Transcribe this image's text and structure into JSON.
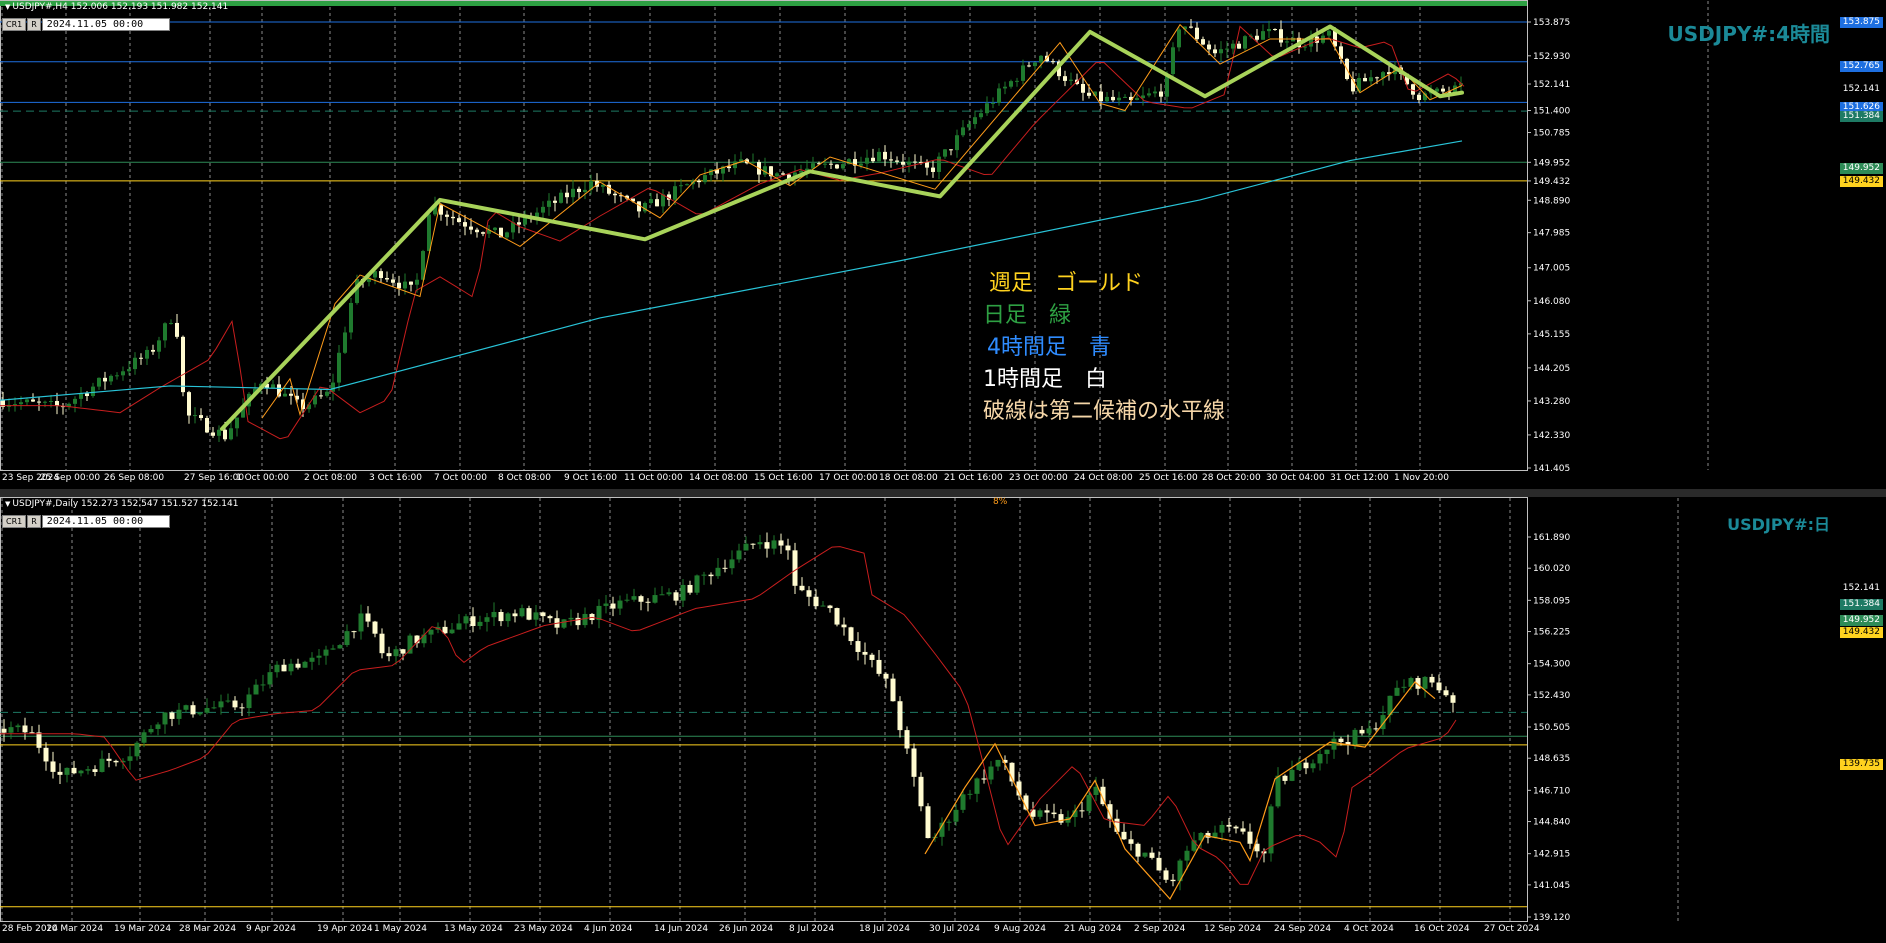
{
  "colors": {
    "bg": "#000000",
    "bull": "#1f7a2e",
    "bear": "#fffbd0",
    "ema_h4": "#29c4d8",
    "red_ma": "#c81e1e",
    "zigzag": "#a8d35a",
    "zigzag_small": "#ff9c1a",
    "weekly": "#ffd21f",
    "daily": "#2e8b57",
    "h4line": "#1e6fe0",
    "dash": "#1e7a64",
    "watermark": "#1b8a98"
  },
  "h4": {
    "title": "USDJPY#,H4  152.006 152.193 151.982 152.141",
    "cr_label": "CR1",
    "r_label": "R",
    "datetime": "2024.11.05 00:00",
    "watermark": "USDJPY#:4時間",
    "price_labels": [
      "153.875",
      "152.930",
      "152.141",
      "151.400",
      "150.785",
      "149.952",
      "149.432",
      "148.890",
      "147.985",
      "147.005",
      "146.080",
      "145.155",
      "144.205",
      "143.280",
      "142.330",
      "141.405"
    ],
    "date_labels": [
      "23 Sep 2024",
      "25 Sep 00:00",
      "26 Sep 08:00",
      "27 Sep 16:00",
      "1 Oct 00:00",
      "2 Oct 08:00",
      "3 Oct 16:00",
      "7 Oct 00:00",
      "8 Oct 08:00",
      "9 Oct 16:00",
      "11 Oct 00:00",
      "14 Oct 08:00",
      "15 Oct 16:00",
      "17 Oct 00:00",
      "18 Oct 08:00",
      "21 Oct 16:00",
      "23 Oct 00:00",
      "24 Oct 08:00",
      "25 Oct 16:00",
      "28 Oct 20:00",
      "30 Oct 04:00",
      "31 Oct 12:00",
      "1 Nov 20:00"
    ],
    "tags": [
      {
        "value": "153.875",
        "bg": "#1e6fe0",
        "fg": "#ffffff"
      },
      {
        "value": "152.765",
        "bg": "#1e6fe0",
        "fg": "#ffffff"
      },
      {
        "value": "152.141",
        "bg": "#000000",
        "fg": "#ffffff"
      },
      {
        "value": "151.626",
        "bg": "#1e6fe0",
        "fg": "#ffffff"
      },
      {
        "value": "151.384",
        "bg": "#1e7a64",
        "fg": "#ffffff"
      },
      {
        "value": "149.952",
        "bg": "#2e8b57",
        "fg": "#ffffff"
      },
      {
        "value": "149.432",
        "bg": "#ffd21f",
        "fg": "#000000"
      }
    ],
    "legend": [
      {
        "text": "週足　ゴールド",
        "color": "#ffd21f"
      },
      {
        "text": "日足　緑",
        "color": "#2ea043"
      },
      {
        "text": "4時間足　青",
        "color": "#2f8cff"
      },
      {
        "text": "1時間足　白",
        "color": "#ffffff"
      },
      {
        "text": "破線は第二候補の水平線",
        "color": "#f5d6a8"
      }
    ]
  },
  "daily": {
    "title": "USDJPY#,Daily  152.273 152.547 151.527 152.141",
    "cr_label": "CR1",
    "r_label": "R",
    "datetime": "2024.11.05 00:00",
    "watermark": "USDJPY#:日",
    "marker": "8%",
    "price_labels": [
      "161.890",
      "160.020",
      "158.095",
      "156.225",
      "154.300",
      "152.430",
      "150.505",
      "148.635",
      "146.710",
      "144.840",
      "142.915",
      "141.045",
      "139.120"
    ],
    "date_labels": [
      "28 Feb 2024",
      "10 Mar 2024",
      "19 Mar 2024",
      "28 Mar 2024",
      "9 Apr 2024",
      "19 Apr 2024",
      "1 May 2024",
      "13 May 2024",
      "23 May 2024",
      "4 Jun 2024",
      "14 Jun 2024",
      "26 Jun 2024",
      "8 Jul 2024",
      "18 Jul 2024",
      "30 Jul 2024",
      "9 Aug 2024",
      "21 Aug 2024",
      "2 Sep 2024",
      "12 Sep 2024",
      "24 Sep 2024",
      "4 Oct 2024",
      "16 Oct 2024",
      "27 Oct 2024"
    ],
    "tags": [
      {
        "value": "152.141",
        "bg": "#000000",
        "fg": "#ffffff"
      },
      {
        "value": "151.384",
        "bg": "#1e7a64",
        "fg": "#ffffff"
      },
      {
        "value": "149.952",
        "bg": "#2e8b57",
        "fg": "#ffffff"
      },
      {
        "value": "149.432",
        "bg": "#ffd21f",
        "fg": "#000000"
      },
      {
        "value": "139.735",
        "bg": "#ffd21f",
        "fg": "#000000"
      }
    ]
  }
}
